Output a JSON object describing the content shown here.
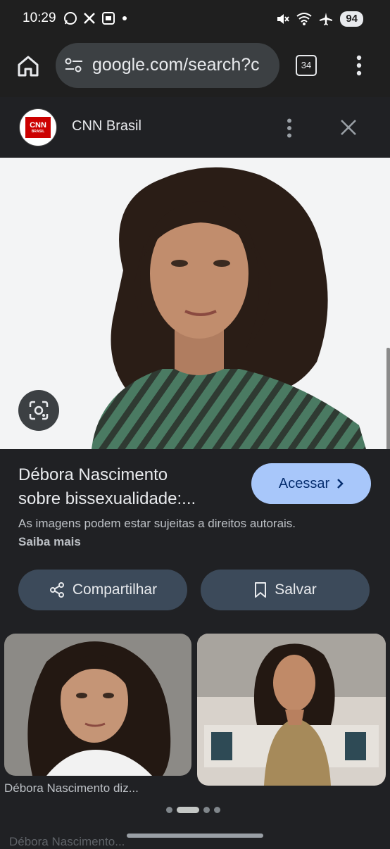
{
  "status_bar": {
    "time": "10:29",
    "battery": "94",
    "left_icons": [
      "whatsapp-icon",
      "x-icon",
      "screenshot-icon",
      "dot-icon"
    ],
    "right_icons": [
      "mute-icon",
      "wifi-icon",
      "airplane-icon"
    ]
  },
  "toolbar": {
    "url": "google.com/search?c",
    "tab_count": "34"
  },
  "panel": {
    "source_name": "CNN Brasil",
    "logo_text": "CNN",
    "logo_sub": "BRASIL"
  },
  "result": {
    "title_line1": "Débora Nascimento",
    "title_line2": "sobre bissexualidade:...",
    "access_label": "Acessar",
    "rights_text": "As imagens podem estar sujeitas a direitos autorais.",
    "learn_more": "Saiba mais",
    "share_label": "Compartilhar",
    "save_label": "Salvar"
  },
  "related": [
    {
      "caption": "Débora Nascimento diz..."
    },
    {
      "caption": "Débora Nascimento..."
    }
  ],
  "colors": {
    "background": "#202124",
    "accent_button": "#a8c7fa",
    "action_button": "#3c4a5a"
  }
}
